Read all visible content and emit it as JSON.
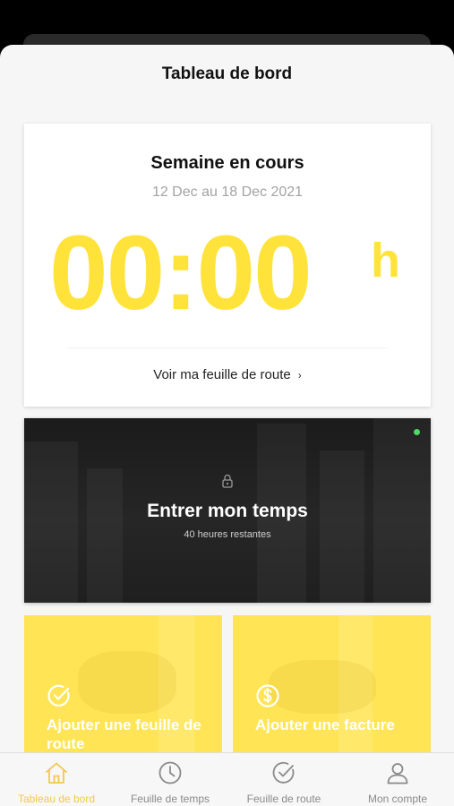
{
  "header": {
    "title": "Tableau de bord"
  },
  "week": {
    "title": "Semaine en cours",
    "range": "12 Dec au 18 Dec 2021",
    "hours": "00:00",
    "unit": "h",
    "link_label": "Voir ma feuille de route",
    "link_chevron": "›"
  },
  "enter_time": {
    "title": "Entrer mon temps",
    "subtitle": "40 heures restantes",
    "status_color": "#4cd964"
  },
  "tiles": [
    {
      "label": "Ajouter une feuille de route",
      "icon": "check-circle-icon"
    },
    {
      "label": "Ajouter une facture",
      "icon": "dollar-circle-icon"
    }
  ],
  "tabs": [
    {
      "label": "Tableau de bord",
      "icon": "home-icon",
      "active": true
    },
    {
      "label": "Feuille de temps",
      "icon": "clock-icon",
      "active": false
    },
    {
      "label": "Feuille de route",
      "icon": "check-circle-icon",
      "active": false
    },
    {
      "label": "Mon compte",
      "icon": "user-icon",
      "active": false
    }
  ],
  "colors": {
    "accent": "#ffe33b",
    "tab_active": "#f2c94c",
    "tab_inactive": "#8a8a8a"
  }
}
